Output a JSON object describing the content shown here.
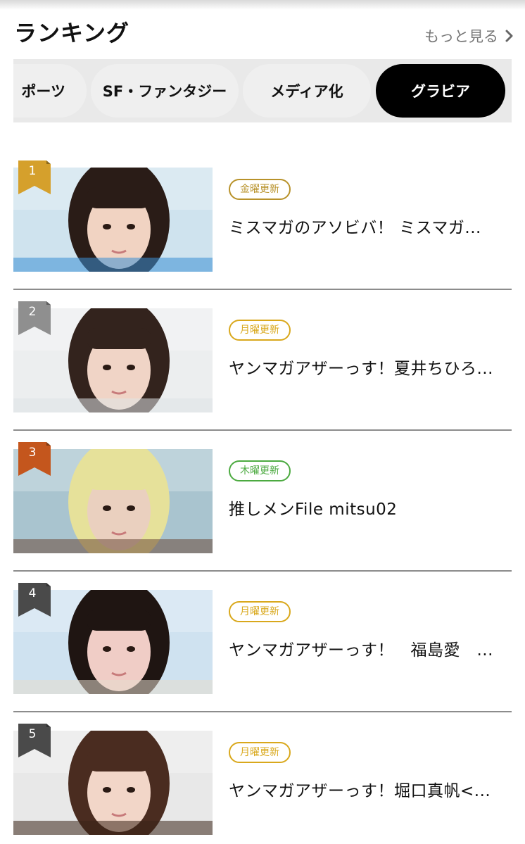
{
  "header": {
    "title": "ランキング",
    "more_label": "もっと見る"
  },
  "tabs": [
    {
      "label": "ポーツ",
      "active": false
    },
    {
      "label": "SF・ファンタジー",
      "active": false
    },
    {
      "label": "メディア化",
      "active": false
    },
    {
      "label": "グラビア",
      "active": true
    }
  ],
  "ranking": [
    {
      "rank": "1",
      "ribbon_color": "#d5a02c",
      "badge": "金曜更新",
      "badge_color": "#b8922a",
      "title": "ミスマガのアソビバ！ ミスマガ...",
      "photo": {
        "bg": "#cfe3ee",
        "hair": "#2a1c17",
        "skin": "#f1d3c2",
        "accent": "#3b8fd6"
      }
    },
    {
      "rank": "2",
      "ribbon_color": "#8f8f8f",
      "badge": "月曜更新",
      "badge_color": "#d9a81c",
      "title": "ヤンマガアザーっす！夏井ちひろ...",
      "photo": {
        "bg": "#eceeef",
        "hair": "#33231d",
        "skin": "#f0d4c6",
        "accent": "#dfe3e6"
      }
    },
    {
      "rank": "3",
      "ribbon_color": "#c4561d",
      "badge": "木曜更新",
      "badge_color": "#4caa40",
      "title": "推しメンFile mitsu02",
      "photo": {
        "bg": "#a9c4cf",
        "hair": "#e6e19a",
        "skin": "#ead0bf",
        "accent": "#6b4a3a"
      }
    },
    {
      "rank": "4",
      "ribbon_color": "#4a4a4a",
      "badge": "月曜更新",
      "badge_color": "#d9a81c",
      "title": "ヤンマガアザーっす！　福島愛　...",
      "photo": {
        "bg": "#cfe2f0",
        "hair": "#1f1512",
        "skin": "#f0cdc6",
        "accent": "#e6dccd"
      }
    },
    {
      "rank": "5",
      "ribbon_color": "#4a4a4a",
      "badge": "月曜更新",
      "badge_color": "#d9a81c",
      "title": "ヤンマガアザーっす！堀口真帆<...",
      "photo": {
        "bg": "#e8e8e8",
        "hair": "#4a2c20",
        "skin": "#f2d6c8",
        "accent": "#3a2418"
      }
    }
  ]
}
